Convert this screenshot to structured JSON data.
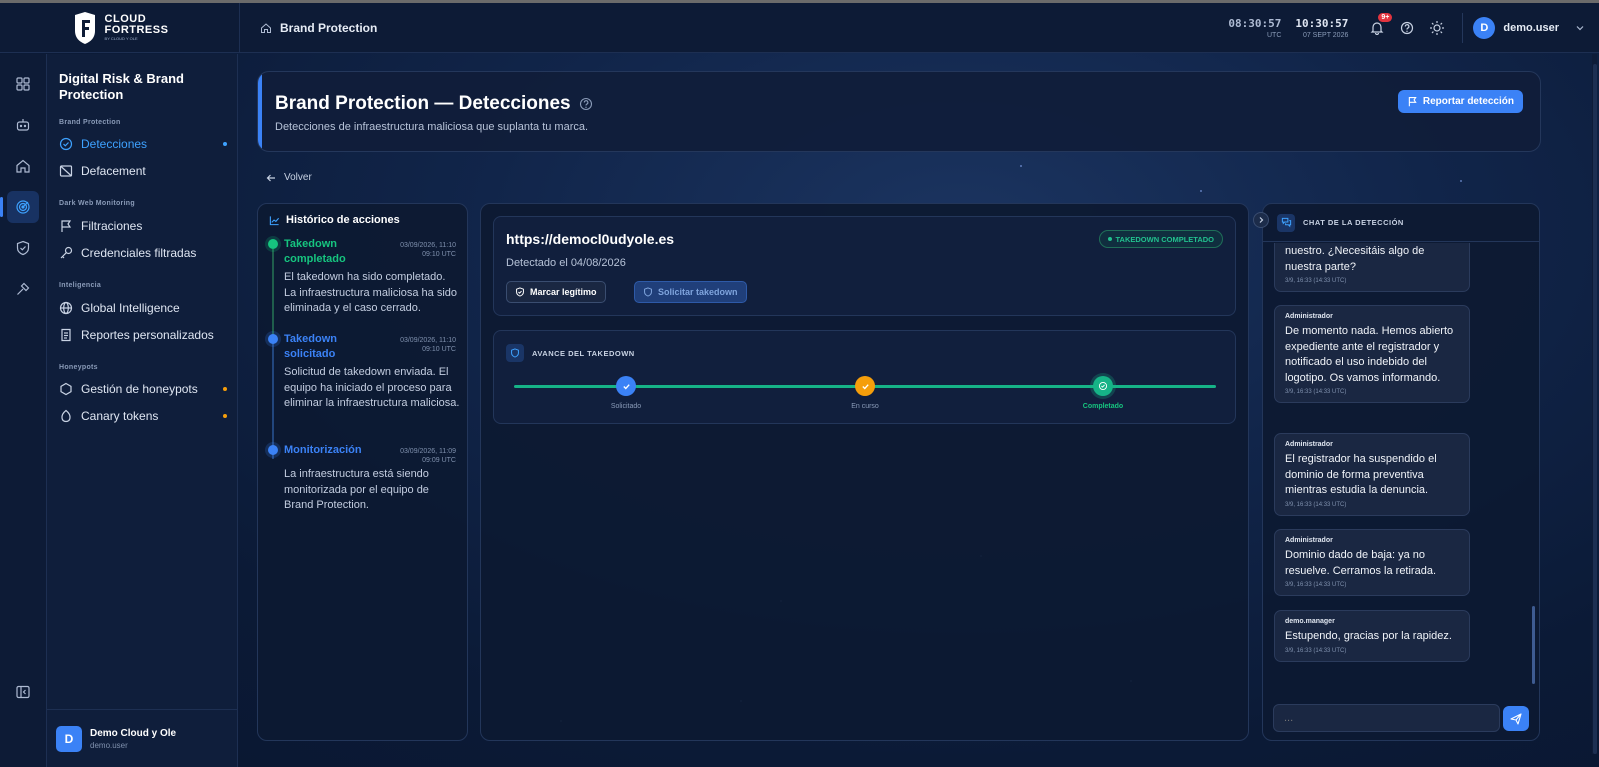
{
  "app": {
    "logo_line1": "CLOUD",
    "logo_line2": "FORTRESS",
    "logo_line3": "BY CLOUD Y OLE"
  },
  "header": {
    "breadcrumb": "Brand Protection",
    "utc_time": "08:30:57",
    "utc_label": "UTC",
    "local_time": "10:30:57",
    "local_date": "07 SEPT 2026",
    "notif_badge": "9+",
    "username": "demo.user"
  },
  "rail": {
    "icons": [
      "dashboard-icon",
      "bot-icon",
      "home-icon",
      "radar-icon",
      "shield-icon",
      "tools-icon",
      "collapse-icon"
    ]
  },
  "sidebar": {
    "title": "Digital Risk & Brand Protection",
    "sections": [
      {
        "label": "Brand Protection",
        "items": [
          {
            "label": "Detecciones",
            "active": true
          },
          {
            "label": "Defacement"
          }
        ]
      },
      {
        "label": "Dark Web Monitoring",
        "items": [
          {
            "label": "Filtraciones"
          },
          {
            "label": "Credenciales filtradas"
          }
        ]
      },
      {
        "label": "Inteligencia",
        "items": [
          {
            "label": "Global Intelligence"
          },
          {
            "label": "Reportes personalizados"
          }
        ]
      },
      {
        "label": "Honeypots",
        "items": [
          {
            "label": "Gestión de honeypots"
          },
          {
            "label": "Canary tokens"
          }
        ]
      }
    ],
    "footer": {
      "avatar": "D",
      "org": "Demo Cloud y Ole",
      "user": "demo.user"
    }
  },
  "page": {
    "title": "Brand Protection — Detecciones",
    "subtitle": "Detecciones de infraestructura maliciosa que suplanta tu marca.",
    "report_button": "Reportar detección",
    "back": "Volver"
  },
  "history": {
    "title": "Histórico de acciones",
    "items": [
      {
        "title": "Takedown completado",
        "date": "03/09/2026, 11:10",
        "time": "09:10 UTC",
        "text": "El takedown ha sido completado. La infraestructura maliciosa ha sido eliminada y el caso cerrado."
      },
      {
        "title": "Takedown solicitado",
        "date": "03/09/2026, 11:10",
        "time": "09:10 UTC",
        "text": "Solicitud de takedown enviada. El equipo ha iniciado el proceso para eliminar la infraestructura maliciosa."
      },
      {
        "title": "Monitorización",
        "date": "03/09/2026, 11:09",
        "time": "09:09 UTC",
        "text": "La infraestructura está siendo monitorizada por el equipo de Brand Protection."
      }
    ]
  },
  "detection": {
    "url": "https://democl0udyole.es",
    "detected": "Detectado el 04/08/2026",
    "status": "TAKEDOWN COMPLETADO",
    "btn_legit": "Marcar legítimo",
    "btn_takedown": "Solicitar takedown"
  },
  "progress": {
    "title": "AVANCE DEL TAKEDOWN",
    "steps": [
      {
        "label": "Solicitado",
        "color": "#3b82f6"
      },
      {
        "label": "En curso",
        "color": "#f59e0b"
      },
      {
        "label": "Completado",
        "color": "#16b387"
      }
    ]
  },
  "chat": {
    "title": "CHAT DE LA DETECCIÓN",
    "messages": [
      {
        "who": "",
        "text": "nuestro. ¿Necesitáis algo de nuestra parte?",
        "ts": "3/9, 16:33 (14:33 UTC)"
      },
      {
        "who": "Administrador",
        "text": "De momento nada. Hemos abierto expediente ante el registrador y notificado el uso indebido del logotipo. Os vamos informando.",
        "ts": "3/9, 16:33 (14:33 UTC)"
      },
      {
        "who": "Administrador",
        "text": "El registrador ha suspendido el dominio de forma preventiva mientras estudia la denuncia.",
        "ts": "3/9, 16:33 (14:33 UTC)"
      },
      {
        "who": "Administrador",
        "text": "Dominio dado de baja: ya no resuelve. Cerramos la retirada.",
        "ts": "3/9, 16:33 (14:33 UTC)"
      },
      {
        "who": "demo.manager",
        "text": "Estupendo, gracias por la rapidez.",
        "ts": "3/9, 16:33 (14:33 UTC)"
      }
    ],
    "placeholder": "..."
  },
  "colors": {
    "accent": "#3b82f6",
    "success": "#22c08e",
    "warning": "#f59e0b",
    "danger": "#e2343f"
  }
}
